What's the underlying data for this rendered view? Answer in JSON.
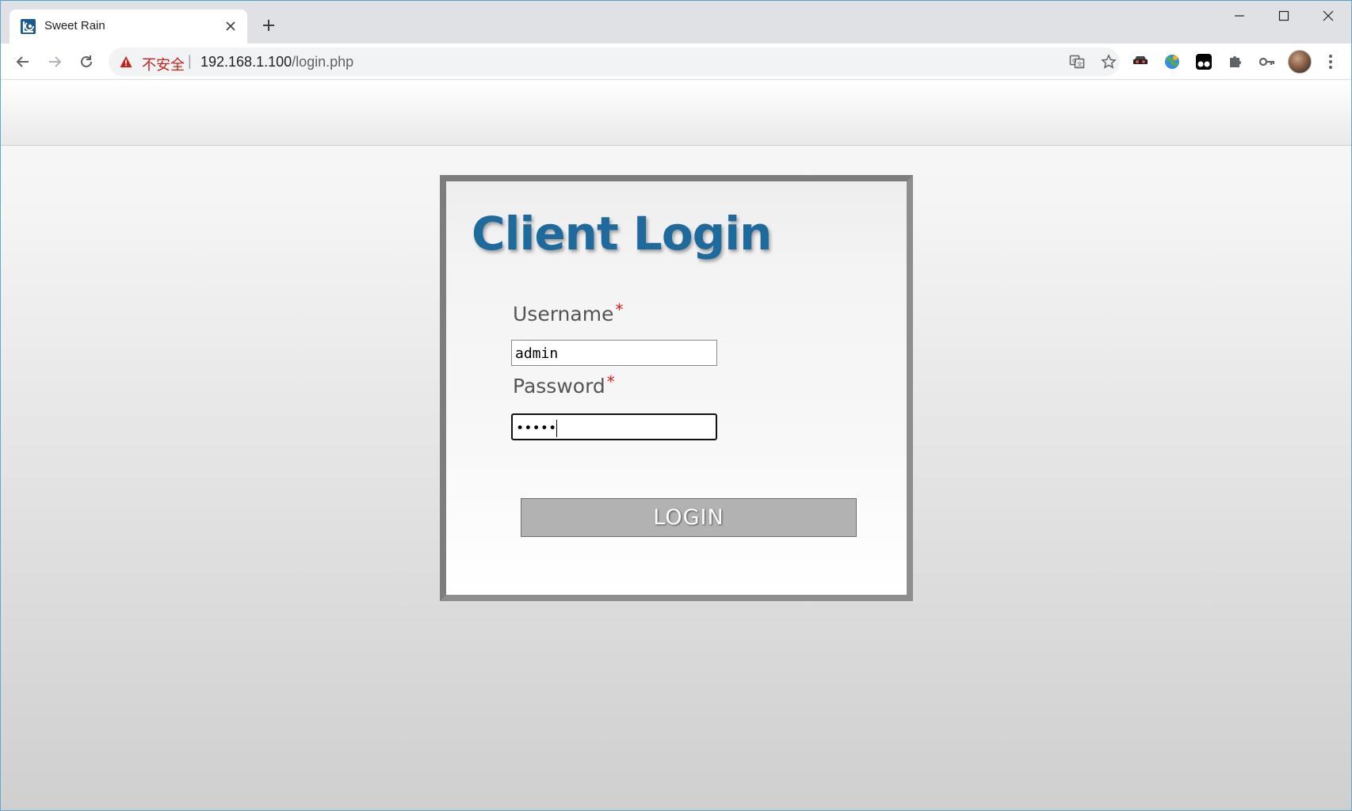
{
  "browser": {
    "tab": {
      "title": "Sweet Rain",
      "favicon": "sweet-rain-logo"
    },
    "newtab_icon": "plus-icon",
    "window_controls": [
      "minimize-icon",
      "maximize-icon",
      "close-icon"
    ],
    "nav": {
      "back": "back-arrow-icon",
      "forward": "forward-arrow-icon",
      "reload": "reload-icon"
    },
    "address_bar": {
      "security_icon": "warning-icon",
      "security_label": "不安全",
      "separator": "|",
      "host": "192.168.1.100",
      "path": "/login.php"
    },
    "omnibox_icons": [
      "translate-icon",
      "star-icon"
    ],
    "extensions": [
      "incognito-glasses-icon",
      "globe-extension-icon",
      "tampermonkey-icon",
      "puzzle-icon",
      "key-icon"
    ],
    "menu_icon": "more-vertical-icon"
  },
  "login": {
    "title": "Client Login",
    "username_label": "Username",
    "password_label": "Password",
    "required_marker": "*",
    "username_value": "admin",
    "password_mask": "•••••",
    "button_label": "LOGIN"
  },
  "colors": {
    "title": "#1f6a9c",
    "required": "#e31b1b",
    "button": "#b2b2b2",
    "insecure": "#c5221f"
  }
}
